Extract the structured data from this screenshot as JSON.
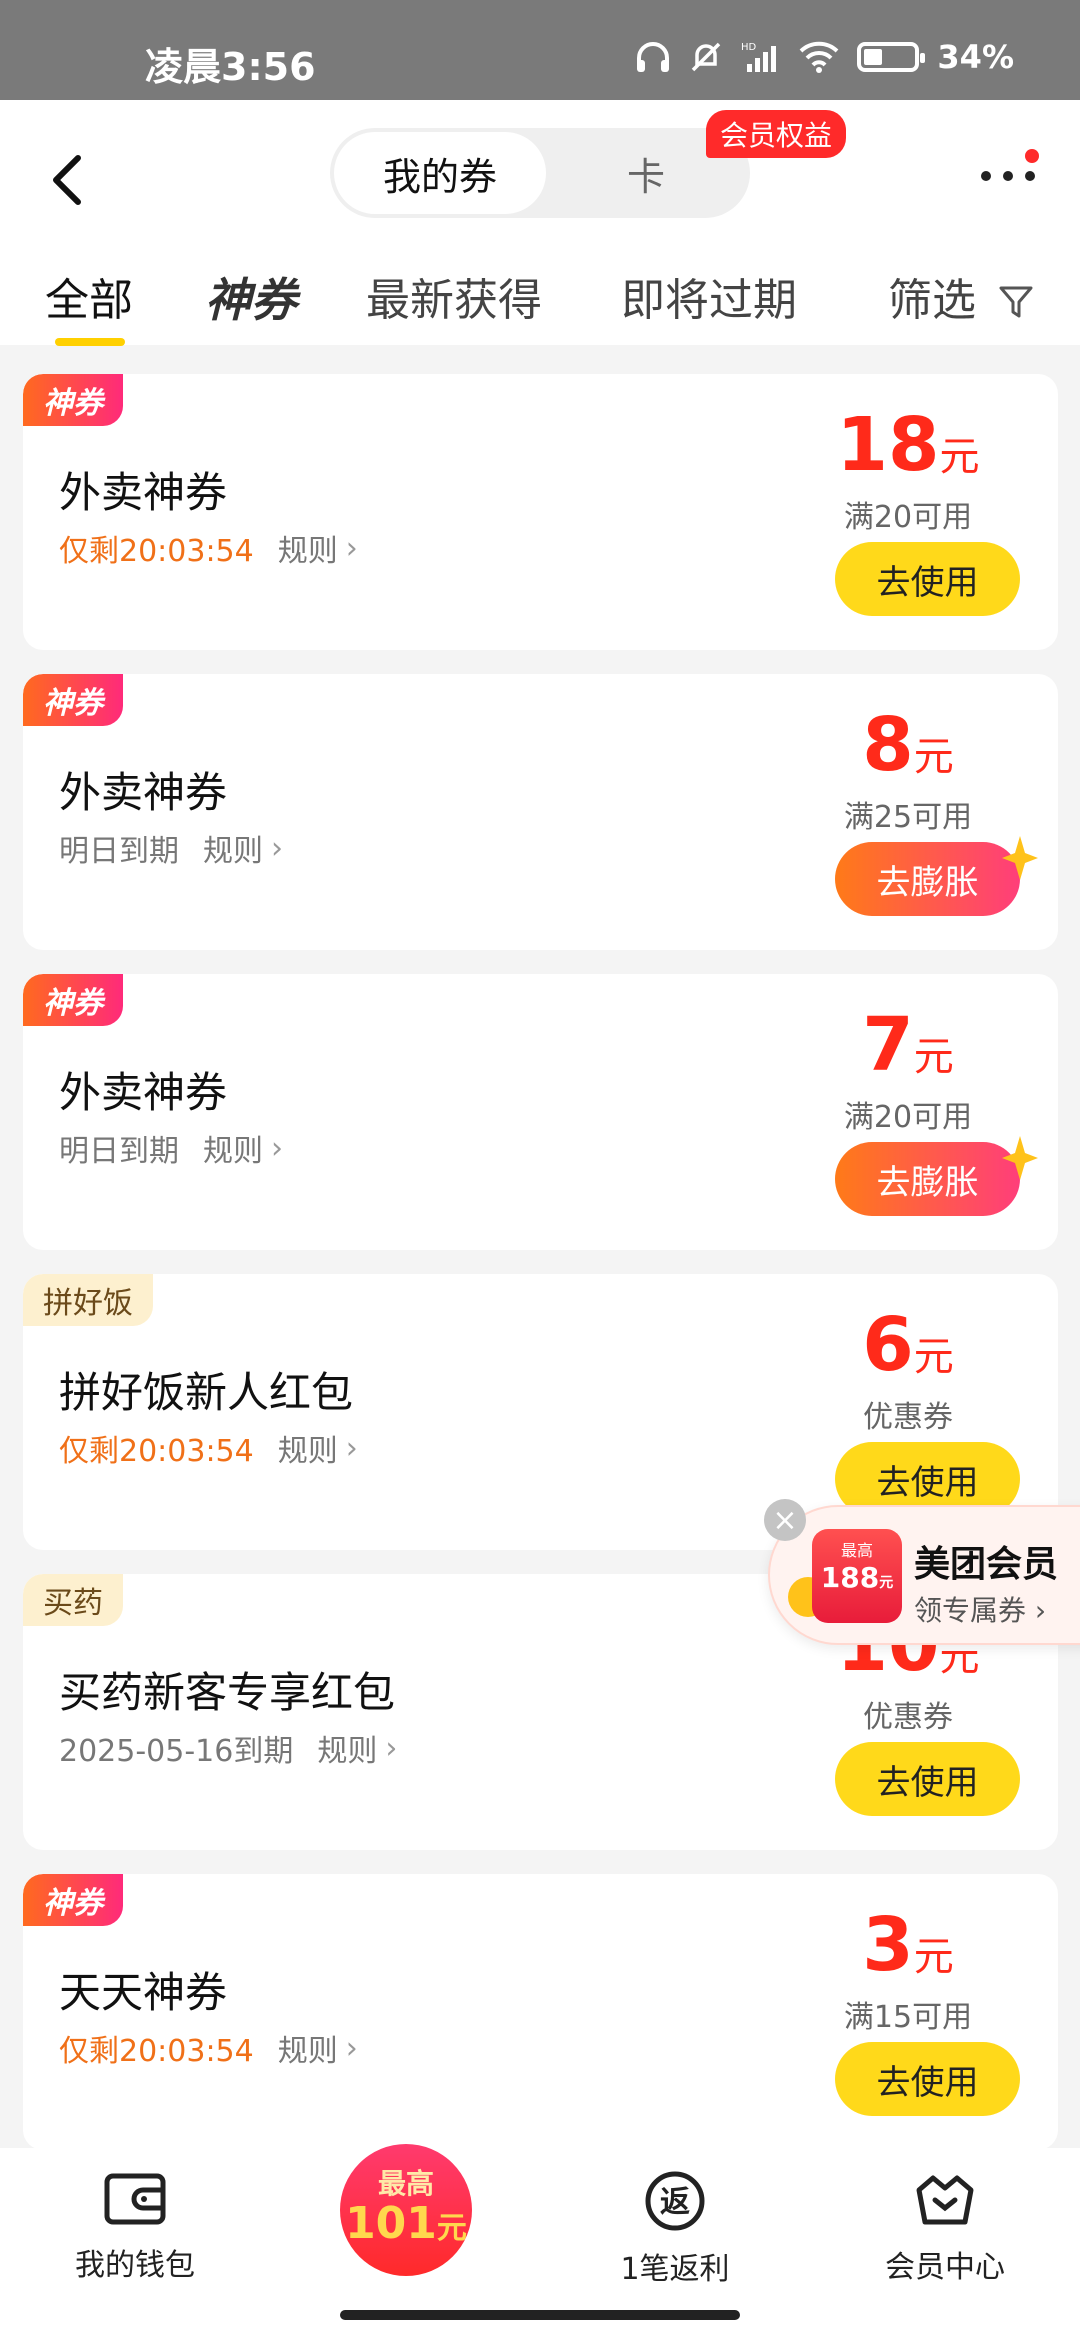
{
  "status_bar": {
    "time": "凌晨3:56",
    "battery": "34%"
  },
  "header": {
    "segment": {
      "active": "我的券",
      "inactive": "卡"
    },
    "vip_tag": "会员权益"
  },
  "tabs": [
    {
      "label": "全部"
    },
    {
      "label": "神券"
    },
    {
      "label": "最新获得"
    },
    {
      "label": "即将过期"
    },
    {
      "label": "筛选"
    }
  ],
  "coupons": [
    {
      "badge": "神券",
      "title": "外卖神券",
      "expiry": "仅剩20:03:54",
      "rule": "规则",
      "amount": "18",
      "unit": "元",
      "condition": "满20可用",
      "button": "去使用"
    },
    {
      "badge": "神券",
      "title": "外卖神券",
      "expiry": "明日到期",
      "rule": "规则",
      "amount": "8",
      "unit": "元",
      "condition": "满25可用",
      "button": "去膨胀"
    },
    {
      "badge": "神券",
      "title": "外卖神券",
      "expiry": "明日到期",
      "rule": "规则",
      "amount": "7",
      "unit": "元",
      "condition": "满20可用",
      "button": "去膨胀"
    },
    {
      "badge": "拼好饭",
      "title": "拼好饭新人红包",
      "expiry": "仅剩20:03:54",
      "rule": "规则",
      "amount": "6",
      "unit": "元",
      "condition": "优惠券",
      "button": "去使用"
    },
    {
      "badge": "买药",
      "title": "买药新客专享红包",
      "expiry": "2025-05-16到期",
      "rule": "规则",
      "amount": "10",
      "unit": "元",
      "condition": "优惠券",
      "button": "去使用"
    },
    {
      "badge": "神券",
      "title": "天天神券",
      "expiry": "仅剩20:03:54",
      "rule": "规则",
      "amount": "3",
      "unit": "元",
      "condition": "满15可用",
      "button": "去使用"
    }
  ],
  "floating": {
    "pack_top": "最高",
    "pack_value": "188",
    "pack_unit": "元",
    "title": "美团会员",
    "subtitle": "领专属券"
  },
  "bottom_nav": {
    "wallet": "我的钱包",
    "center_top": "最高",
    "center_value": "101",
    "center_unit": "元",
    "rebate": "1笔返利",
    "member": "会员中心"
  },
  "colors": {
    "accent_yellow": "#ffd91a",
    "price_red": "#ff2a1a",
    "expiry_orange": "#f07018"
  }
}
